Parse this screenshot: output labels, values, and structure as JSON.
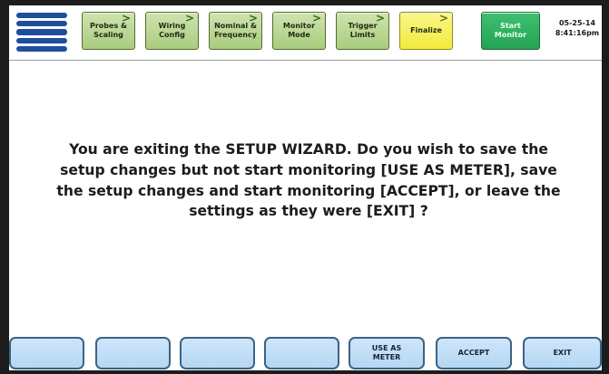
{
  "header": {
    "tabs": [
      {
        "label": "Probes &\nScaling",
        "has_arrow": true
      },
      {
        "label": "Wiring\nConfig",
        "has_arrow": true
      },
      {
        "label": "Nominal &\nFrequency",
        "has_arrow": true
      },
      {
        "label": "Monitor\nMode",
        "has_arrow": true
      },
      {
        "label": "Trigger\nLimits",
        "has_arrow": true
      },
      {
        "label": "Finalize",
        "has_arrow": true,
        "state": "current"
      },
      {
        "label": "Start\nMonitor",
        "has_arrow": false,
        "state": "action"
      }
    ],
    "arrow_glyph": ">",
    "date": "05-25-14",
    "time": "8:41:16pm"
  },
  "message": "You are exiting the SETUP WIZARD.  Do you wish to save the setup changes but not start monitoring [USE AS METER], save the setup changes and start monitoring [ACCEPT], or leave the settings as they were [EXIT] ?",
  "softkeys": [
    {
      "label": ""
    },
    {
      "label": ""
    },
    {
      "label": ""
    },
    {
      "label": ""
    },
    {
      "label": "USE AS\nMETER"
    },
    {
      "label": "ACCEPT"
    },
    {
      "label": "EXIT"
    }
  ],
  "colors": {
    "tab_green": "#a9cc7d",
    "tab_finalize_yellow": "#f2ea3c",
    "tab_start_green": "#23a353",
    "softkey_blue": "#b5d6f3",
    "logo_blue": "#1f4f9c"
  },
  "icons": {
    "logo": "stripes-logo-icon"
  }
}
